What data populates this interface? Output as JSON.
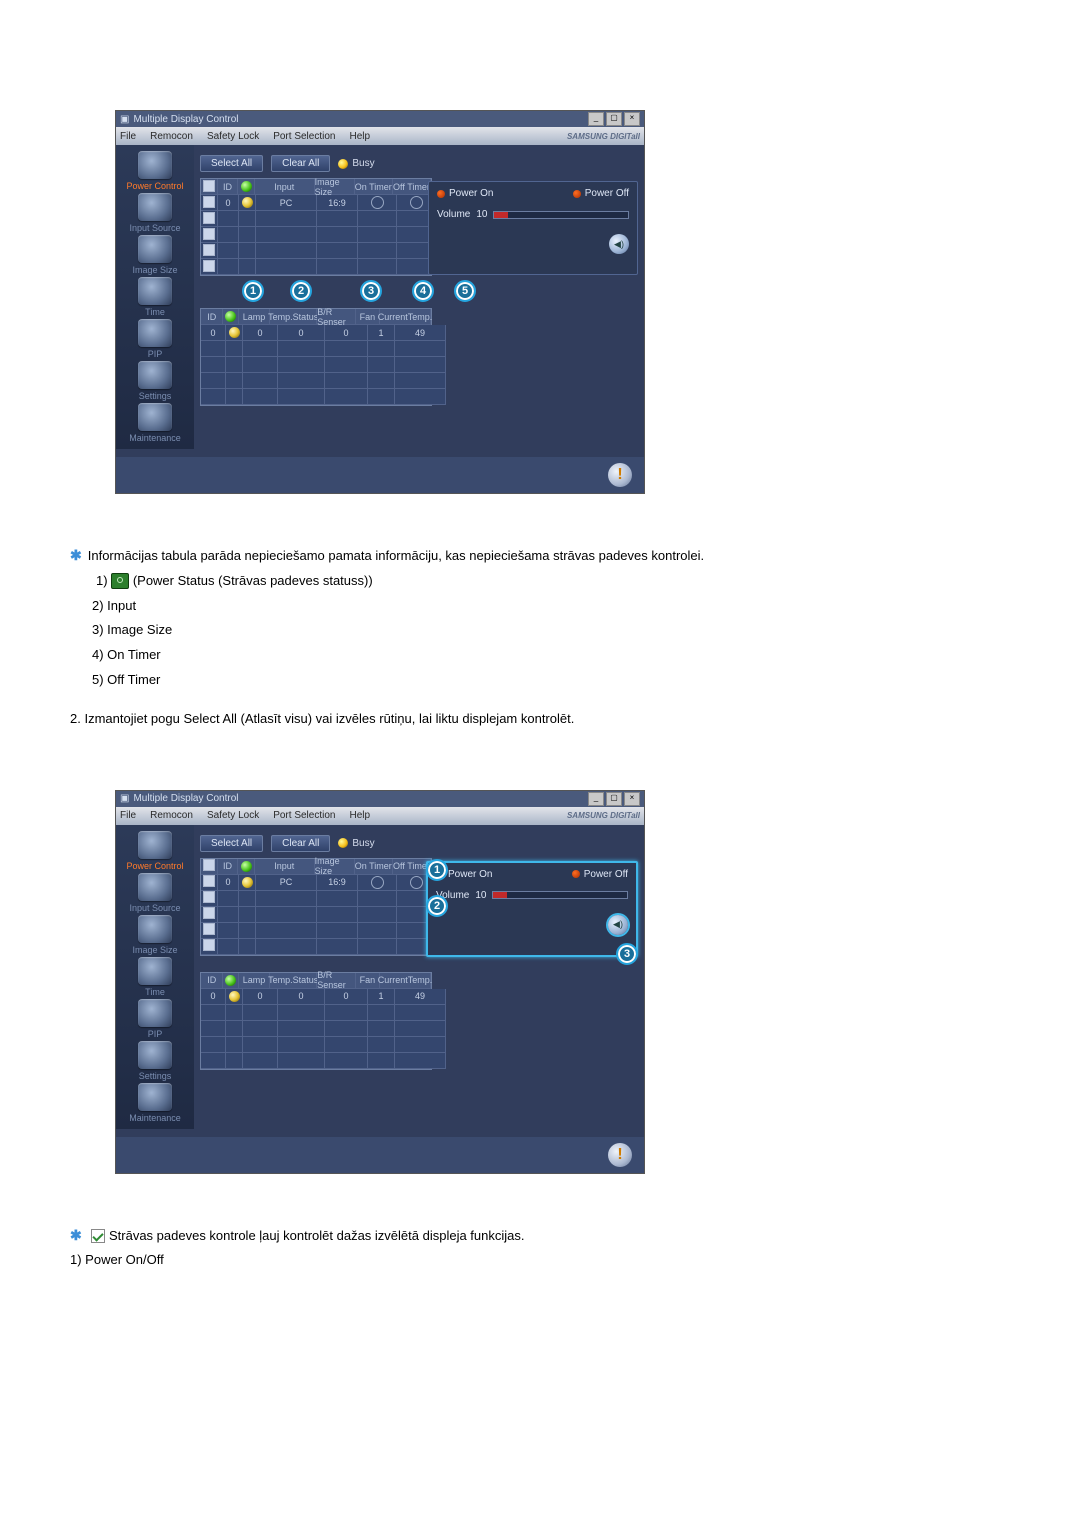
{
  "app": {
    "title": "Multiple Display Control",
    "brand": "SAMSUNG DIGITall",
    "menus": [
      "File",
      "Remocon",
      "Safety Lock",
      "Port Selection",
      "Help"
    ],
    "win_buttons": [
      "_",
      "▢",
      "×"
    ]
  },
  "sidebar": [
    {
      "label": "Power Control"
    },
    {
      "label": "Input Source"
    },
    {
      "label": "Image Size"
    },
    {
      "label": "Time"
    },
    {
      "label": "PIP"
    },
    {
      "label": "Settings"
    },
    {
      "label": "Maintenance"
    }
  ],
  "topbar": {
    "select_all": "Select All",
    "clear_all": "Clear All",
    "busy": "Busy"
  },
  "grid1": {
    "headers": [
      "",
      "ID",
      "",
      "Input",
      "Image Size",
      "On Timer",
      "Off Timer"
    ],
    "row": {
      "id": "0",
      "input": "PC",
      "image_size": "16:9"
    }
  },
  "grid2": {
    "headers": [
      "ID",
      "",
      "Lamp",
      "Temp.Status",
      "B/R Senser",
      "Fan",
      "CurrentTemp."
    ],
    "row": {
      "id": "0",
      "lamp": "0",
      "temp_status": "0",
      "br": "0",
      "fan": "1",
      "ct": "49"
    }
  },
  "panel": {
    "power_on": "Power On",
    "power_off": "Power Off",
    "volume_label": "Volume",
    "volume_value": "10"
  },
  "callouts_a": [
    "1",
    "2",
    "3",
    "4",
    "5"
  ],
  "callouts_b": [
    "1",
    "2",
    "3"
  ],
  "text": {
    "intro": "Informācijas tabula parāda nepieciešamo pamata informāciju, kas nepieciešama strāvas padeves kontrolei.",
    "l1": "1)",
    "l1b": "(Power Status (Strāvas padeves statuss))",
    "l2": "2) Input",
    "l3": "3) Image Size",
    "l4": "4) On Timer",
    "l5": "5) Off Timer",
    "p2": "2.  Izmantojiet pogu Select All (Atlasīt visu) vai izvēles rūtiņu, lai liktu displejam kontrolēt.",
    "out2": "Strāvas padeves kontrole ļauj kontrolēt dažas izvēlētā displeja funkcijas.",
    "o1": "1)  Power On/Off"
  }
}
